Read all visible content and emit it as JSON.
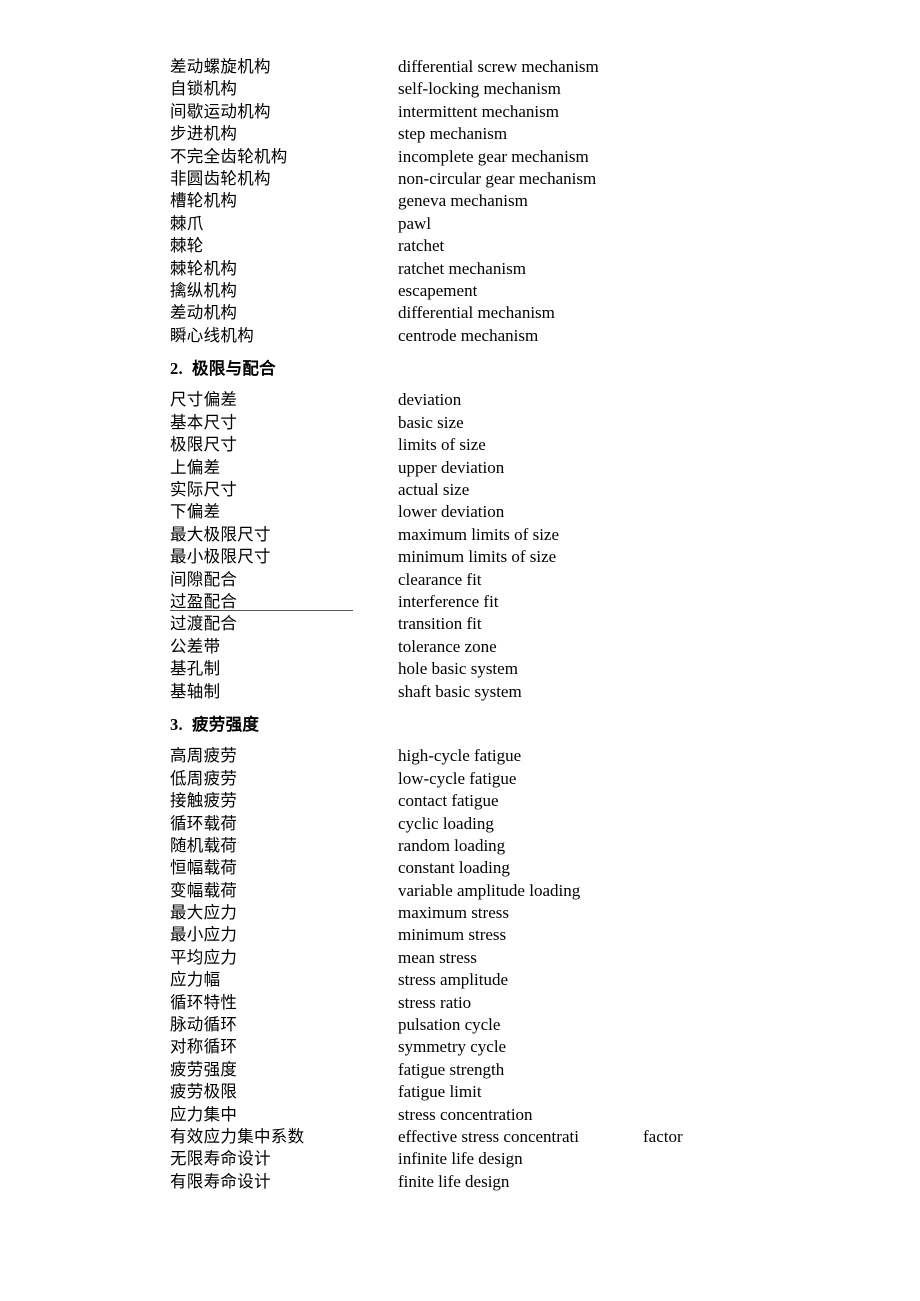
{
  "document": {
    "background_color": "#ffffff",
    "text_color": "#000000",
    "rule_color": "#55555a"
  },
  "sections": [
    {
      "heading": null,
      "rows": [
        {
          "cn": "差动螺旋机构",
          "en": "differential screw mechanism"
        },
        {
          "cn": "自锁机构",
          "en": "self-locking mechanism"
        },
        {
          "cn": "间歇运动机构",
          "en": "intermittent mechanism"
        },
        {
          "cn": "步进机构",
          "en": "step mechanism"
        },
        {
          "cn": "不完全齿轮机构",
          "en": "incomplete gear mechanism"
        },
        {
          "cn": "非圆齿轮机构",
          "en": "non-circular gear mechanism"
        },
        {
          "cn": "槽轮机构",
          "en": "geneva mechanism"
        },
        {
          "cn": "棘爪",
          "en": "pawl"
        },
        {
          "cn": "棘轮",
          "en": "ratchet"
        },
        {
          "cn": "棘轮机构",
          "en": "ratchet mechanism"
        },
        {
          "cn": "擒纵机构",
          "en": "escapement"
        },
        {
          "cn": "差动机构",
          "en": "differential mechanism"
        },
        {
          "cn": "瞬心线机构",
          "en": "centrode mechanism"
        }
      ]
    },
    {
      "heading": {
        "number": "2.",
        "title": "极限与配合"
      },
      "rows": [
        {
          "cn": "尺寸偏差",
          "en": "deviation"
        },
        {
          "cn": "基本尺寸",
          "en": "basic size"
        },
        {
          "cn": "极限尺寸",
          "en": "limits of size"
        },
        {
          "cn": "上偏差",
          "en": "upper deviation"
        },
        {
          "cn": "实际尺寸",
          "en": "actual size"
        },
        {
          "cn": "下偏差",
          "en": "lower deviation"
        },
        {
          "cn": "最大极限尺寸",
          "en": "maximum limits of size"
        },
        {
          "cn": "最小极限尺寸",
          "en": "minimum limits of size"
        },
        {
          "cn": "间隙配合",
          "en": "clearance fit"
        },
        {
          "cn": "过盈配合",
          "en": "interference fit",
          "ruled": true
        },
        {
          "cn": "过渡配合",
          "en": "transition fit"
        },
        {
          "cn": "公差带",
          "en": "tolerance zone"
        },
        {
          "cn": "基孔制",
          "en": "hole basic system"
        },
        {
          "cn": "基轴制",
          "en": "shaft basic system"
        }
      ]
    },
    {
      "heading": {
        "number": "3.",
        "title": "疲劳强度"
      },
      "rows": [
        {
          "cn": "高周疲劳",
          "en": "high-cycle fatigue"
        },
        {
          "cn": "低周疲劳",
          "en": "low-cycle fatigue"
        },
        {
          "cn": "接触疲劳",
          "en": "contact fatigue"
        },
        {
          "cn": "循环载荷",
          "en": "cyclic loading"
        },
        {
          "cn": "随机载荷",
          "en": "random loading"
        },
        {
          "cn": "恒幅载荷",
          "en": "constant loading"
        },
        {
          "cn": "变幅载荷",
          "en": "variable amplitude loading"
        },
        {
          "cn": "最大应力",
          "en": "maximum stress"
        },
        {
          "cn": "最小应力",
          "en": "minimum stress"
        },
        {
          "cn": "平均应力",
          "en": "mean stress"
        },
        {
          "cn": "应力幅",
          "en": "stress amplitude"
        },
        {
          "cn": "循环特性",
          "en": "stress ratio"
        },
        {
          "cn": "脉动循环",
          "en": "pulsation cycle"
        },
        {
          "cn": "对称循环",
          "en": "symmetry cycle"
        },
        {
          "cn": "疲劳强度",
          "en": "fatigue strength"
        },
        {
          "cn": "疲劳极限",
          "en": "fatigue limit"
        },
        {
          "cn": "应力集中",
          "en": "stress concentration"
        },
        {
          "cn": "有效应力集中系数",
          "en": "effective stress concentrati",
          "trailing": "factor"
        },
        {
          "cn": "无限寿命设计",
          "en": "infinite life design"
        },
        {
          "cn": "有限寿命设计",
          "en": "finite life design"
        }
      ]
    }
  ]
}
